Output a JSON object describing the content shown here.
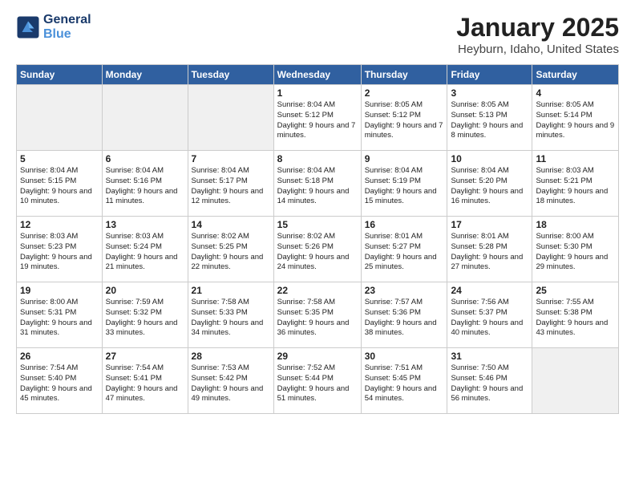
{
  "logo": {
    "line1": "General",
    "line2": "Blue"
  },
  "title": "January 2025",
  "location": "Heyburn, Idaho, United States",
  "weekdays": [
    "Sunday",
    "Monday",
    "Tuesday",
    "Wednesday",
    "Thursday",
    "Friday",
    "Saturday"
  ],
  "weeks": [
    [
      {
        "day": "",
        "info": ""
      },
      {
        "day": "",
        "info": ""
      },
      {
        "day": "",
        "info": ""
      },
      {
        "day": "1",
        "info": "Sunrise: 8:04 AM\nSunset: 5:12 PM\nDaylight: 9 hours\nand 7 minutes."
      },
      {
        "day": "2",
        "info": "Sunrise: 8:05 AM\nSunset: 5:12 PM\nDaylight: 9 hours\nand 7 minutes."
      },
      {
        "day": "3",
        "info": "Sunrise: 8:05 AM\nSunset: 5:13 PM\nDaylight: 9 hours\nand 8 minutes."
      },
      {
        "day": "4",
        "info": "Sunrise: 8:05 AM\nSunset: 5:14 PM\nDaylight: 9 hours\nand 9 minutes."
      }
    ],
    [
      {
        "day": "5",
        "info": "Sunrise: 8:04 AM\nSunset: 5:15 PM\nDaylight: 9 hours\nand 10 minutes."
      },
      {
        "day": "6",
        "info": "Sunrise: 8:04 AM\nSunset: 5:16 PM\nDaylight: 9 hours\nand 11 minutes."
      },
      {
        "day": "7",
        "info": "Sunrise: 8:04 AM\nSunset: 5:17 PM\nDaylight: 9 hours\nand 12 minutes."
      },
      {
        "day": "8",
        "info": "Sunrise: 8:04 AM\nSunset: 5:18 PM\nDaylight: 9 hours\nand 14 minutes."
      },
      {
        "day": "9",
        "info": "Sunrise: 8:04 AM\nSunset: 5:19 PM\nDaylight: 9 hours\nand 15 minutes."
      },
      {
        "day": "10",
        "info": "Sunrise: 8:04 AM\nSunset: 5:20 PM\nDaylight: 9 hours\nand 16 minutes."
      },
      {
        "day": "11",
        "info": "Sunrise: 8:03 AM\nSunset: 5:21 PM\nDaylight: 9 hours\nand 18 minutes."
      }
    ],
    [
      {
        "day": "12",
        "info": "Sunrise: 8:03 AM\nSunset: 5:23 PM\nDaylight: 9 hours\nand 19 minutes."
      },
      {
        "day": "13",
        "info": "Sunrise: 8:03 AM\nSunset: 5:24 PM\nDaylight: 9 hours\nand 21 minutes."
      },
      {
        "day": "14",
        "info": "Sunrise: 8:02 AM\nSunset: 5:25 PM\nDaylight: 9 hours\nand 22 minutes."
      },
      {
        "day": "15",
        "info": "Sunrise: 8:02 AM\nSunset: 5:26 PM\nDaylight: 9 hours\nand 24 minutes."
      },
      {
        "day": "16",
        "info": "Sunrise: 8:01 AM\nSunset: 5:27 PM\nDaylight: 9 hours\nand 25 minutes."
      },
      {
        "day": "17",
        "info": "Sunrise: 8:01 AM\nSunset: 5:28 PM\nDaylight: 9 hours\nand 27 minutes."
      },
      {
        "day": "18",
        "info": "Sunrise: 8:00 AM\nSunset: 5:30 PM\nDaylight: 9 hours\nand 29 minutes."
      }
    ],
    [
      {
        "day": "19",
        "info": "Sunrise: 8:00 AM\nSunset: 5:31 PM\nDaylight: 9 hours\nand 31 minutes."
      },
      {
        "day": "20",
        "info": "Sunrise: 7:59 AM\nSunset: 5:32 PM\nDaylight: 9 hours\nand 33 minutes."
      },
      {
        "day": "21",
        "info": "Sunrise: 7:58 AM\nSunset: 5:33 PM\nDaylight: 9 hours\nand 34 minutes."
      },
      {
        "day": "22",
        "info": "Sunrise: 7:58 AM\nSunset: 5:35 PM\nDaylight: 9 hours\nand 36 minutes."
      },
      {
        "day": "23",
        "info": "Sunrise: 7:57 AM\nSunset: 5:36 PM\nDaylight: 9 hours\nand 38 minutes."
      },
      {
        "day": "24",
        "info": "Sunrise: 7:56 AM\nSunset: 5:37 PM\nDaylight: 9 hours\nand 40 minutes."
      },
      {
        "day": "25",
        "info": "Sunrise: 7:55 AM\nSunset: 5:38 PM\nDaylight: 9 hours\nand 43 minutes."
      }
    ],
    [
      {
        "day": "26",
        "info": "Sunrise: 7:54 AM\nSunset: 5:40 PM\nDaylight: 9 hours\nand 45 minutes."
      },
      {
        "day": "27",
        "info": "Sunrise: 7:54 AM\nSunset: 5:41 PM\nDaylight: 9 hours\nand 47 minutes."
      },
      {
        "day": "28",
        "info": "Sunrise: 7:53 AM\nSunset: 5:42 PM\nDaylight: 9 hours\nand 49 minutes."
      },
      {
        "day": "29",
        "info": "Sunrise: 7:52 AM\nSunset: 5:44 PM\nDaylight: 9 hours\nand 51 minutes."
      },
      {
        "day": "30",
        "info": "Sunrise: 7:51 AM\nSunset: 5:45 PM\nDaylight: 9 hours\nand 54 minutes."
      },
      {
        "day": "31",
        "info": "Sunrise: 7:50 AM\nSunset: 5:46 PM\nDaylight: 9 hours\nand 56 minutes."
      },
      {
        "day": "",
        "info": ""
      }
    ]
  ]
}
